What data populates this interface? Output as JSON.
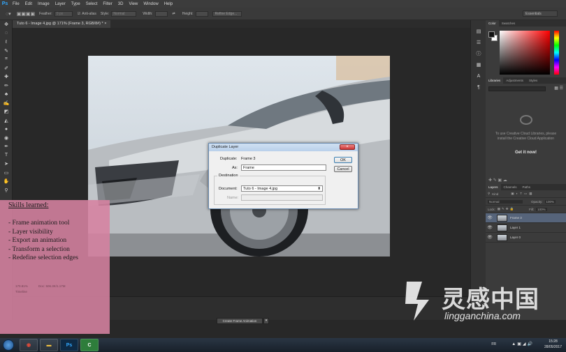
{
  "app": {
    "logo": "Ps",
    "menus": [
      "File",
      "Edit",
      "Image",
      "Layer",
      "Type",
      "Select",
      "Filter",
      "3D",
      "View",
      "Window",
      "Help"
    ]
  },
  "options": {
    "feather_label": "Feather:",
    "feather_value": "0 px",
    "antialias_label": "Anti-alias",
    "style_label": "Style:",
    "style_value": "Normal",
    "width_label": "Width:",
    "height_label": "Height:",
    "refine_label": "Refine Edge...",
    "workspace": "Essentials"
  },
  "document": {
    "tab_title": "Tuto 6 - Image 4.jpg @ 171% (Frame 3, RGB/8#) *",
    "close": "×"
  },
  "timeline": {
    "create_button": "Create Frame Animation"
  },
  "panels": {
    "color_tabs": [
      "Color",
      "Swatches"
    ],
    "library_tabs": [
      "Libraries",
      "Adjustments",
      "Styles"
    ],
    "library_message": "To use Creative Cloud Libraries, please install the Creative Cloud Application",
    "library_link": "Get it now!",
    "layers_tabs": [
      "Layers",
      "Channels",
      "Paths"
    ],
    "kind": "Kind",
    "blend_mode": "Normal",
    "opacity_label": "Opacity:",
    "opacity_value": "100%",
    "lock_label": "Lock:",
    "fill_label": "Fill:",
    "fill_value": "100%",
    "layers": [
      {
        "name": "Frame 3",
        "selected": true
      },
      {
        "name": "Layer 1",
        "selected": false
      },
      {
        "name": "Layer 0",
        "selected": false
      }
    ]
  },
  "dialog": {
    "title": "Duplicate Layer",
    "duplicate_label": "Duplicate:",
    "duplicate_value": "Frame 3",
    "as_label": "As:",
    "as_value": "Frame",
    "destination_label": "Destination",
    "document_label": "Document:",
    "document_value": "Tuto 6 - Image 4.jpg",
    "name_label": "Name:",
    "ok": "OK",
    "cancel": "Cancel"
  },
  "overlay": {
    "title": "Skills learned:",
    "items": [
      "- Frame animation tool",
      "- Layer visibility",
      "- Export an animation",
      "- Transform a selection",
      "- Redefine selection edges"
    ],
    "faint_zoom": "170.81%",
    "faint_doc": "Doc: 506.3K/1.17M",
    "faint_timeline": "Timeline"
  },
  "watermark": {
    "cn": "灵感中国",
    "en": "lingganchina.com"
  },
  "taskbar": {
    "lang": "FR",
    "time": "15:28",
    "date": "28/05/2017"
  }
}
